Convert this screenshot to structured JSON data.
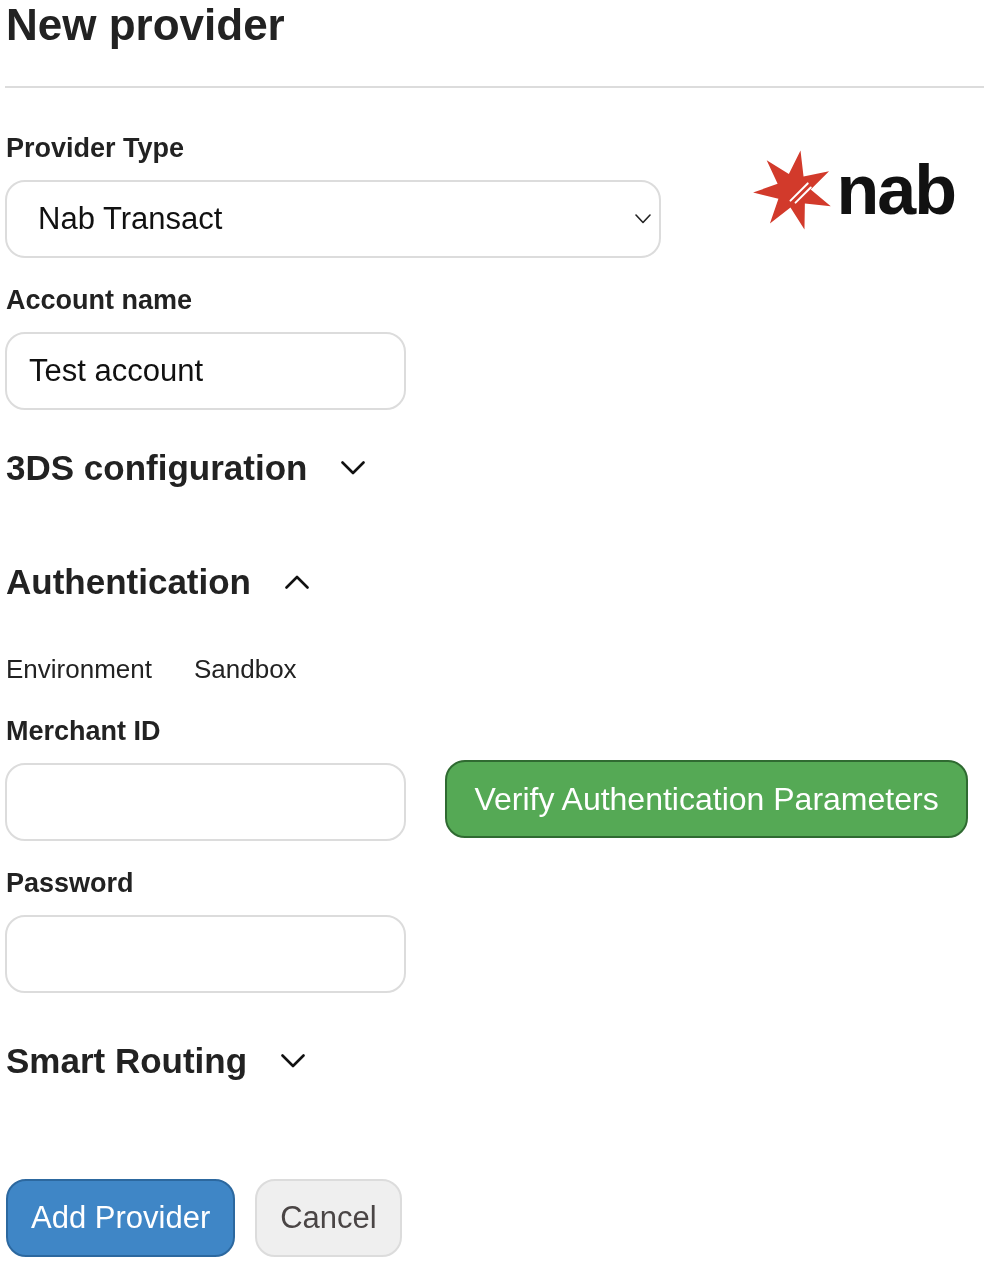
{
  "page": {
    "title": "New provider"
  },
  "form": {
    "provider_type": {
      "label": "Provider Type",
      "value": "Nab Transact"
    },
    "logo": {
      "wordmark": "nab"
    },
    "account_name": {
      "label": "Account name",
      "value": "Test account"
    },
    "sections": [
      {
        "title": "3DS configuration",
        "expanded": false
      },
      {
        "title": "Authentication",
        "expanded": true,
        "environment": {
          "label": "Environment",
          "value": "Sandbox"
        },
        "fields": [
          {
            "label": "Merchant ID"
          },
          {
            "label": "Password"
          }
        ],
        "verify_button": {
          "label": "Verify Authentication Parameters"
        }
      },
      {
        "title": "Smart Routing",
        "expanded": false
      }
    ]
  },
  "buttons": [
    {
      "label": "Add Provider",
      "kind": "primary"
    },
    {
      "label": "Cancel",
      "kind": "secondary"
    }
  ]
}
